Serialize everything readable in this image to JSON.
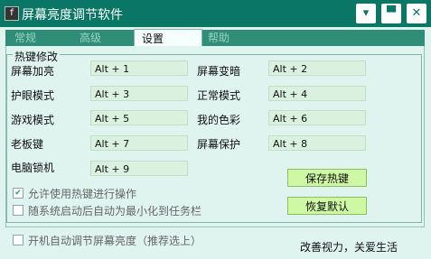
{
  "window": {
    "title": "屏幕亮度调节软件"
  },
  "title_buttons": {
    "minimize": "▾",
    "restore": "▀",
    "close": "✕"
  },
  "tabs": [
    {
      "label": "常规"
    },
    {
      "label": "高级"
    },
    {
      "label": "设置"
    },
    {
      "label": "帮助"
    }
  ],
  "hotkeys": {
    "group_label": "热键修改",
    "items": [
      {
        "label": "屏幕加亮",
        "value": "Alt + 1"
      },
      {
        "label": "屏幕变暗",
        "value": "Alt + 2"
      },
      {
        "label": "护眼模式",
        "value": "Alt + 3"
      },
      {
        "label": "正常模式",
        "value": "Alt + 4"
      },
      {
        "label": "游戏模式",
        "value": "Alt + 5"
      },
      {
        "label": "我的色彩",
        "value": "Alt + 6"
      },
      {
        "label": "老板键",
        "value": "Alt + 7"
      },
      {
        "label": "屏幕保护",
        "value": "Alt + 8"
      },
      {
        "label": "电脑锁机",
        "value": "Alt + 9"
      }
    ],
    "save_label": "保存热键",
    "restore_label": "恢复默认",
    "enable_hotkeys": {
      "label": "允许使用热键进行操作",
      "checked": true
    },
    "minimize_on_start": {
      "label": "随系统启动后自动为最小化到任务栏",
      "checked": false
    }
  },
  "footer": {
    "auto_adjust": {
      "label": "开机自动调节屏幕亮度（推荐选上）",
      "checked": false
    },
    "slogan": "改善视力，关爱生活"
  }
}
